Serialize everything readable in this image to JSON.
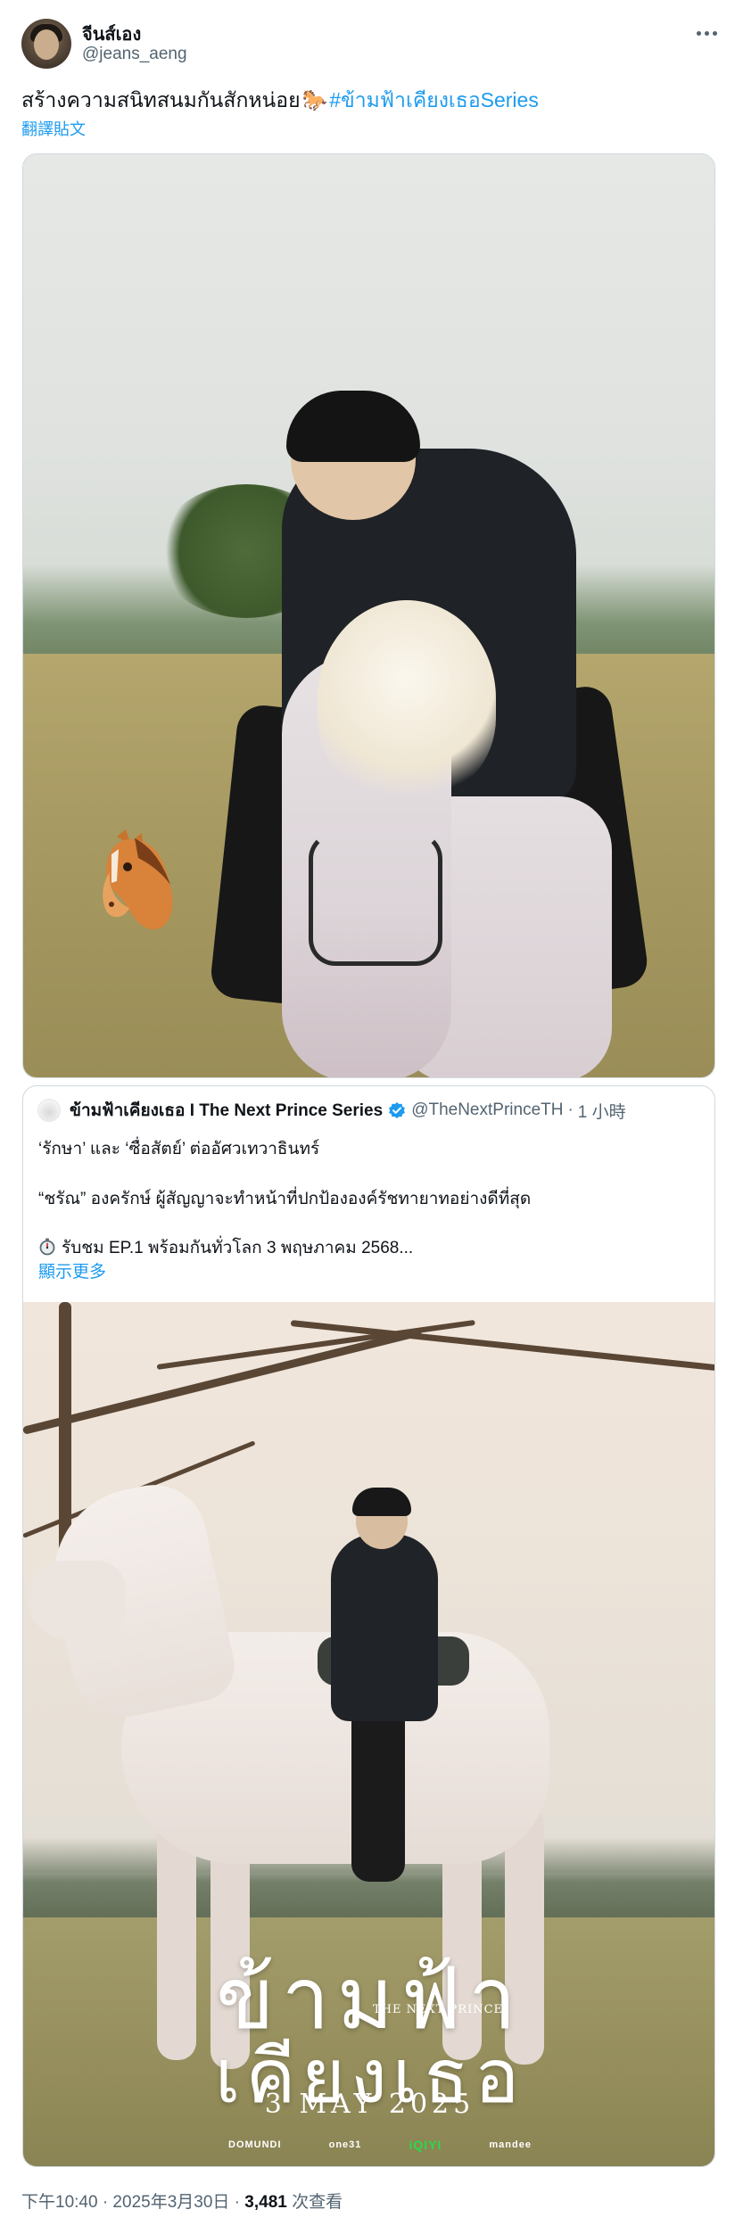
{
  "author": {
    "display_name": "จีนส์เอง",
    "handle": "@jeans_aeng"
  },
  "tweet": {
    "text": "สร้างความสนิทสนมกันสักหน่อย",
    "emoji": "🐎",
    "hashtag": "#ข้ามฟ้าเคียงเธอSeries",
    "translate_label": "翻譯貼文"
  },
  "quoted": {
    "display_name": "ข้ามฟ้าเคียงเธอ I The Next Prince Series",
    "handle": "@TheNextPrinceTH",
    "separator": "·",
    "time": "1 小時",
    "line1": "‘รักษา’ และ ‘ซื่อสัตย์’ ต่ออัศวเทวาธินทร์",
    "line2": "“ชรัณ” องครักษ์ ผู้สัญญาจะทำหน้าที่ปกป้ององค์รัชทายาทอย่างดีที่สุด",
    "line3": "รับชม EP.1 พร้อมกันทั่วโลก 3 พฤษภาคม 2568...",
    "show_more": "顯示更多"
  },
  "poster": {
    "title_line1": "ข้ามฟ้า",
    "title_line2": "เคียงเธอ",
    "subtitle": "THE NEXT PRINCE",
    "date": "3 MAY 2025",
    "logos": [
      "DOMUNDI",
      "one31",
      "iQIYI",
      "mandee"
    ]
  },
  "footer": {
    "time": "下午10:40 · 2025年3月30日 · ",
    "views_count": "3,481",
    "views_label": " 次查看"
  },
  "colors": {
    "link": "#1d9bf0",
    "text": "#0f1419",
    "secondary": "#536471",
    "border": "#cfd9de"
  },
  "icons": {
    "more": "more-dots-icon",
    "verified": "verified-badge-icon",
    "timer": "stopwatch-icon"
  }
}
